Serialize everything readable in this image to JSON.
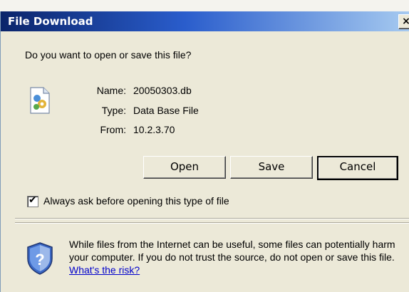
{
  "dialog": {
    "title": "File Download",
    "close_label": "×",
    "question": "Do you want to open or save this file?"
  },
  "file": {
    "name_label": "Name:",
    "name_value": "20050303.db",
    "type_label": "Type:",
    "type_value": "Data Base File",
    "from_label": "From:",
    "from_value": "10.2.3.70"
  },
  "buttons": {
    "open": "Open",
    "save": "Save",
    "cancel": "Cancel"
  },
  "checkbox": {
    "checked": true,
    "label": "Always ask before opening this type of file"
  },
  "warning": {
    "text": "While files from the Internet can be useful, some files can potentially harm your computer. If you do not trust the source, do not open or save this file.",
    "link": "What's the risk?"
  },
  "icons": {
    "file": "file-icon",
    "shield": "shield-icon"
  }
}
